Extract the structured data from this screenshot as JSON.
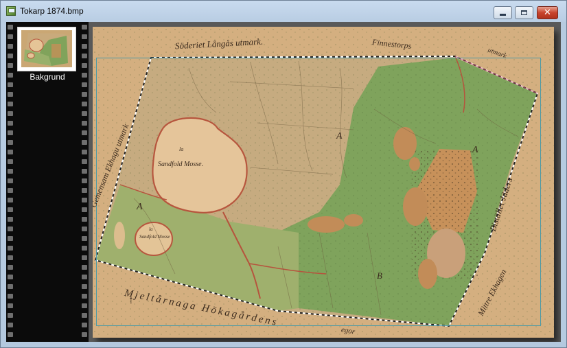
{
  "window": {
    "title": "Tokarp 1874.bmp",
    "icon": "image-file-icon",
    "buttons": {
      "minimize": "minimize-icon",
      "maximize": "maximize-icon",
      "close": "close-icon"
    }
  },
  "filmstrip": {
    "layers": [
      {
        "label": "Bakgrund",
        "selected": true
      }
    ]
  },
  "map": {
    "labels": {
      "top_left": "Söderiet Långås utmark.",
      "top_right": "Finnestorps",
      "top_corner": "utmark",
      "left_edge": "Gemensam Ekhagu utmark",
      "lake_large": "Sandfold Mosse.",
      "lake_large_prefix": "la",
      "lake_small": "Sandfold Mosse",
      "lake_small_prefix": "la",
      "area_a": "A",
      "area_a2": "A",
      "area_b": "B",
      "area_b2": "A",
      "bottom_road": "Mjeltårnaga Hökagårdens",
      "bottom_right": "Mittre Ekhagen",
      "right_edge": "Bistället Jäders",
      "bottom_tail": "egor"
    },
    "colors": {
      "parchment": "#d9b487",
      "meadow": "#9fae6c",
      "forest": "#7ea35a",
      "road": "#b6533d",
      "boundary": "#ffffff"
    }
  }
}
